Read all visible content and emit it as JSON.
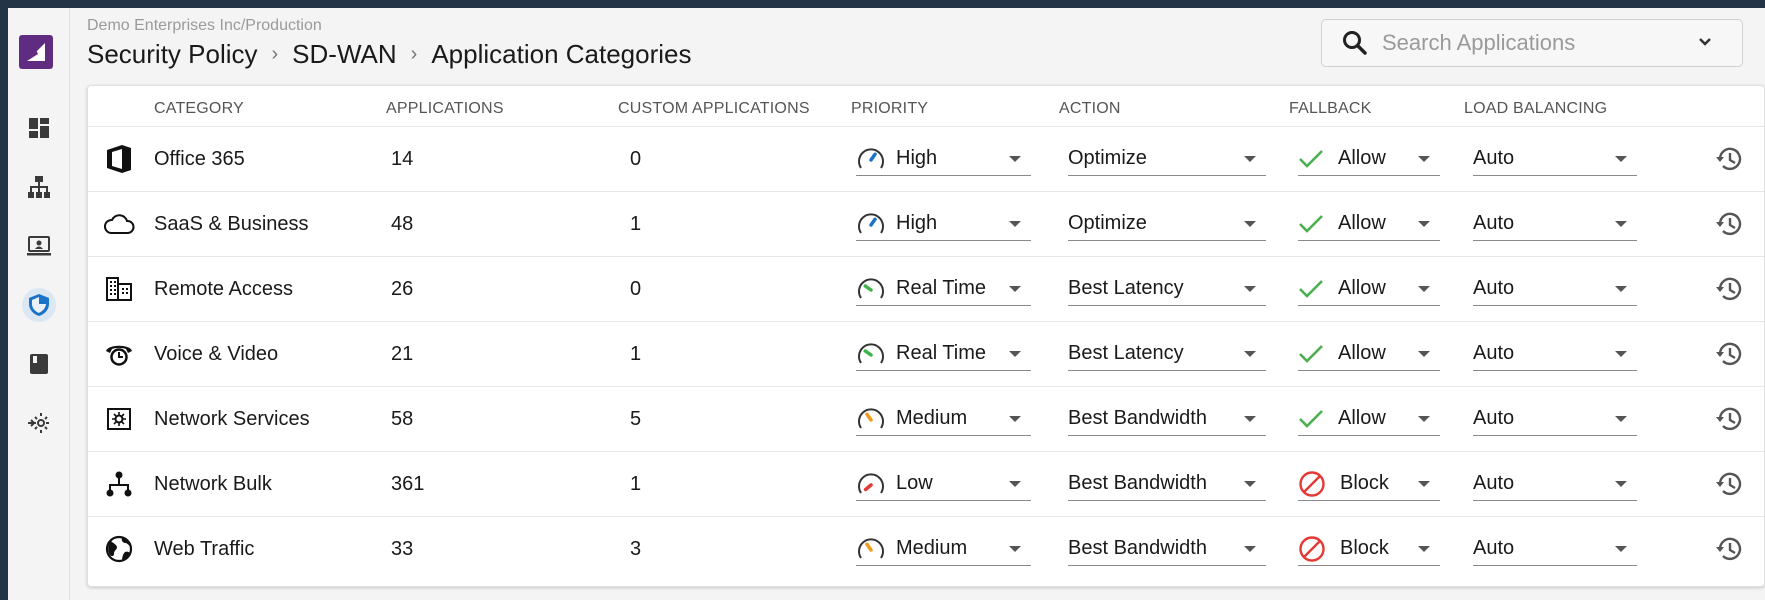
{
  "header": {
    "org_path": "Demo Enterprises Inc/Production",
    "breadcrumb": [
      "Security Policy",
      "SD-WAN",
      "Application Categories"
    ]
  },
  "search": {
    "placeholder": "Search Applications",
    "icon": "search-icon"
  },
  "sidebar": {
    "items": [
      {
        "icon": "dashboard-icon"
      },
      {
        "icon": "network-tree-icon"
      },
      {
        "icon": "monitor-icon"
      },
      {
        "icon": "security-shield-icon",
        "active": true
      },
      {
        "icon": "book-icon"
      },
      {
        "icon": "gear-arrow-icon"
      }
    ]
  },
  "table": {
    "columns": [
      "CATEGORY",
      "APPLICATIONS",
      "CUSTOM APPLICATIONS",
      "PRIORITY",
      "ACTION",
      "FALLBACK",
      "LOAD BALANCING"
    ],
    "rows": [
      {
        "icon": "office-icon",
        "category": "Office 365",
        "applications": "14",
        "custom": "0",
        "priority": "High",
        "priority_color": "#1a73c7",
        "action": "Optimize",
        "fallback": "Allow",
        "fallback_type": "allow",
        "load_balancing": "Auto"
      },
      {
        "icon": "cloud-icon",
        "category": "SaaS & Business",
        "applications": "48",
        "custom": "1",
        "priority": "High",
        "priority_color": "#1a73c7",
        "action": "Optimize",
        "fallback": "Allow",
        "fallback_type": "allow",
        "load_balancing": "Auto"
      },
      {
        "icon": "building-icon",
        "category": "Remote Access",
        "applications": "26",
        "custom": "0",
        "priority": "Real Time",
        "priority_color": "#3bb54a",
        "action": "Best Latency",
        "fallback": "Allow",
        "fallback_type": "allow",
        "load_balancing": "Auto"
      },
      {
        "icon": "phone-icon",
        "category": "Voice & Video",
        "applications": "21",
        "custom": "1",
        "priority": "Real Time",
        "priority_color": "#3bb54a",
        "action": "Best Latency",
        "fallback": "Allow",
        "fallback_type": "allow",
        "load_balancing": "Auto"
      },
      {
        "icon": "settings-box-icon",
        "category": "Network Services",
        "applications": "58",
        "custom": "5",
        "priority": "Medium",
        "priority_color": "#f29a1a",
        "action": "Best Bandwidth",
        "fallback": "Allow",
        "fallback_type": "allow",
        "load_balancing": "Auto"
      },
      {
        "icon": "hierarchy-icon",
        "category": "Network Bulk",
        "applications": "361",
        "custom": "1",
        "priority": "Low",
        "priority_color": "#e53935",
        "action": "Best Bandwidth",
        "fallback": "Block",
        "fallback_type": "block",
        "load_balancing": "Auto"
      },
      {
        "icon": "globe-icon",
        "category": "Web Traffic",
        "applications": "33",
        "custom": "3",
        "priority": "Medium",
        "priority_color": "#f29a1a",
        "action": "Best Bandwidth",
        "fallback": "Block",
        "fallback_type": "block",
        "load_balancing": "Auto"
      }
    ]
  },
  "colors": {
    "allow": "#4caf50",
    "block": "#e53935",
    "brand": "#5f2c82",
    "active_nav": "#1a73c7"
  }
}
